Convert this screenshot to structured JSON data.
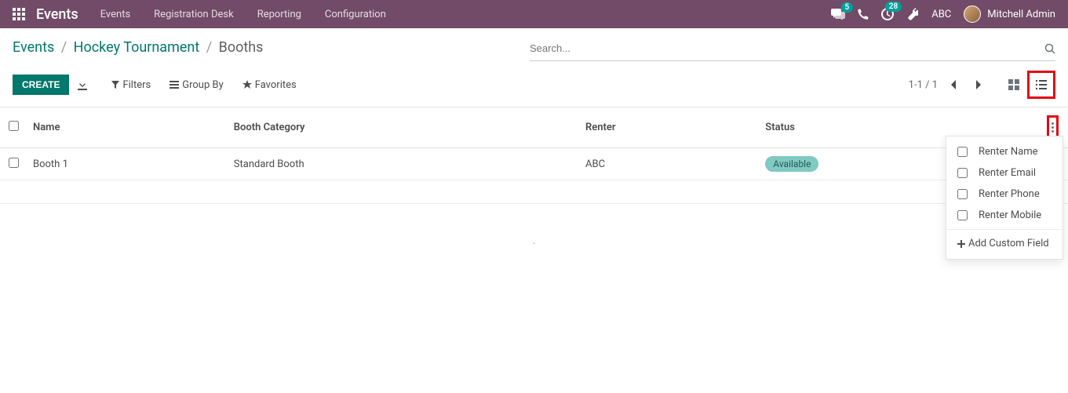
{
  "nav": {
    "brand": "Events",
    "menu": [
      "Events",
      "Registration Desk",
      "Reporting",
      "Configuration"
    ],
    "msg_count": "5",
    "activity_count": "28",
    "company": "ABC",
    "user_name": "Mitchell Admin"
  },
  "breadcrumb": {
    "root": "Events",
    "parent": "Hockey Tournament",
    "current": "Booths"
  },
  "search": {
    "placeholder": "Search..."
  },
  "buttons": {
    "create": "CREATE"
  },
  "search_opts": {
    "filters": "Filters",
    "groupby": "Group By",
    "favorites": "Favorites"
  },
  "pager": {
    "range": "1-1 / 1"
  },
  "columns": {
    "name": "Name",
    "category": "Booth Category",
    "renter": "Renter",
    "status": "Status"
  },
  "rows": [
    {
      "name": "Booth 1",
      "category": "Standard Booth",
      "renter": "ABC",
      "status": "Available"
    }
  ],
  "opt_fields": {
    "items": [
      "Renter Name",
      "Renter Email",
      "Renter Phone",
      "Renter Mobile"
    ],
    "add": "Add Custom Field"
  }
}
